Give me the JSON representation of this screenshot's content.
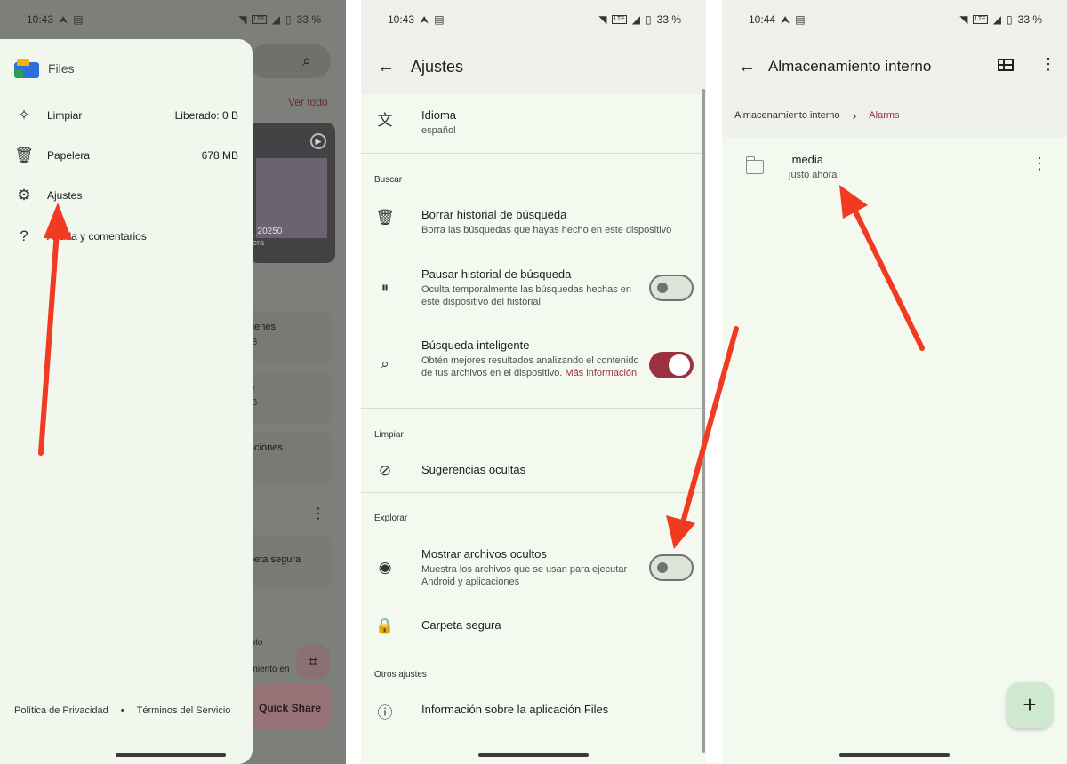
{
  "panel1": {
    "status": {
      "time": "10:43",
      "battery": "33 %"
    },
    "background": {
      "see_all": "Ver todo",
      "thumb_caption": "_20250",
      "thumb_caption2": "era",
      "cards": [
        {
          "title": "genes",
          "sub": "IB"
        },
        {
          "title": "o",
          "sub": "IB"
        },
        {
          "title": "aciones",
          "sub": "3"
        },
        {
          "title": "peta segura",
          "sub": ""
        }
      ],
      "nav_label": "ento",
      "nav_label2": "amiento en",
      "quick_share": "Quick Share"
    },
    "drawer": {
      "brand": "Files",
      "items": [
        {
          "label": "Limpiar",
          "value": "Liberado: 0 B"
        },
        {
          "label": "Papelera",
          "value": "678 MB"
        },
        {
          "label": "Ajustes",
          "value": ""
        },
        {
          "label": "Ayuda y comentarios",
          "value": ""
        }
      ],
      "privacy": "Política de Privacidad",
      "dot": "•",
      "terms": "Términos del Servicio"
    }
  },
  "panel2": {
    "status": {
      "time": "10:43",
      "battery": "33 %"
    },
    "title": "Ajustes",
    "language": {
      "title": "Idioma",
      "sub": "español"
    },
    "section_search": "Buscar",
    "clear_history": {
      "title": "Borrar historial de búsqueda",
      "sub": "Borra las búsquedas que hayas hecho en este dispositivo"
    },
    "pause_history": {
      "title": "Pausar historial de búsqueda",
      "sub": "Oculta temporalmente las búsquedas hechas en este dispositivo del historial",
      "on": false
    },
    "smart_search": {
      "title": "Búsqueda inteligente",
      "sub": "Obtén mejores resultados analizando el contenido de tus archivos en el dispositivo.",
      "link": "Más información",
      "on": true
    },
    "section_clean": "Limpiar",
    "hidden_suggestions": {
      "title": "Sugerencias ocultas"
    },
    "section_explore": "Explorar",
    "show_hidden": {
      "title": "Mostrar archivos ocultos",
      "sub": "Muestra los archivos que se usan para ejecutar Android y aplicaciones",
      "on": false
    },
    "safe_folder": {
      "title": "Carpeta segura"
    },
    "section_other": "Otros ajustes",
    "about": {
      "title": "Información sobre la aplicación Files"
    }
  },
  "panel3": {
    "status": {
      "time": "10:44",
      "battery": "33 %"
    },
    "title": "Almacenamiento interno",
    "breadcrumb": [
      "Almacenamiento interno",
      "Alarms"
    ],
    "folder": {
      "name": ".media",
      "time": "justo ahora"
    },
    "fab": "+"
  },
  "colors": {
    "accent": "#9c3240",
    "arrow": "#f23a22",
    "background": "#f3f9ef"
  }
}
